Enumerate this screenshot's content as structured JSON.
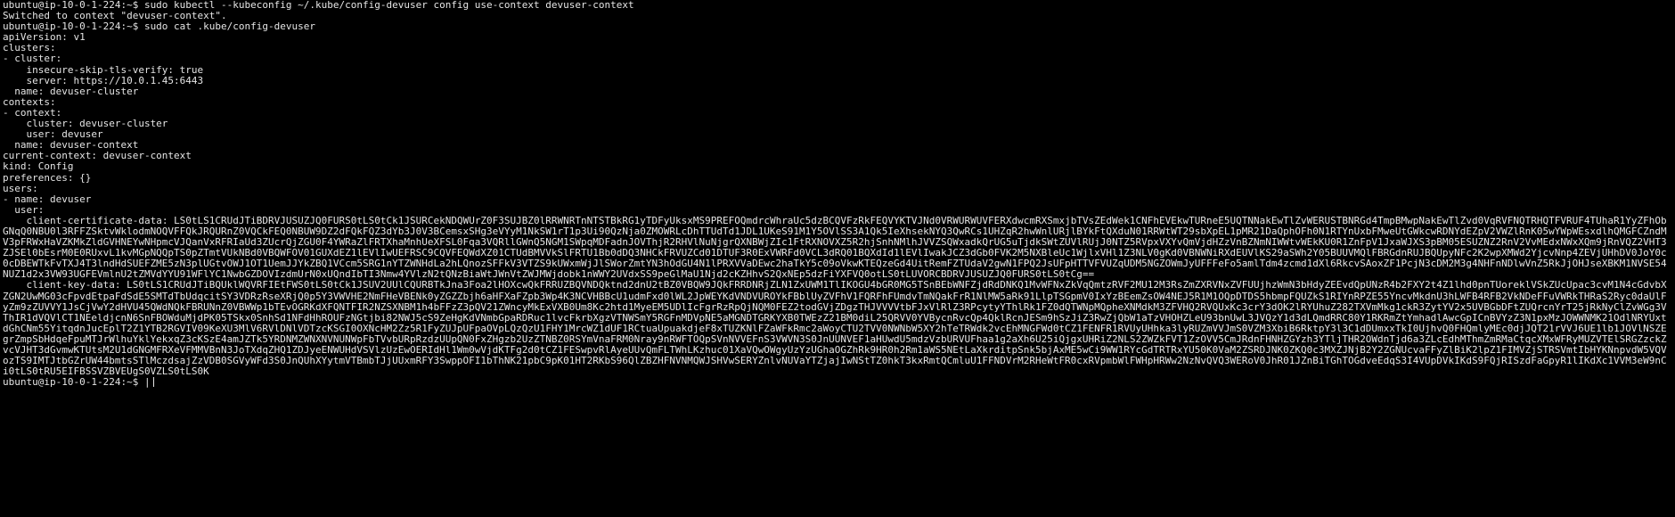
{
  "colors": {
    "background": "#000000",
    "foreground": "#e5e5e5"
  },
  "terminal": {
    "lines": [
      "ubuntu@ip-10-0-1-224:~$ sudo kubectl --kubeconfig ~/.kube/config-devuser config use-context devuser-context",
      "Switched to context \"devuser-context\".",
      "ubuntu@ip-10-0-1-224:~$ sudo cat .kube/config-devuser",
      "apiVersion: v1",
      "clusters:",
      "- cluster:",
      "    insecure-skip-tls-verify: true",
      "    server: https://10.0.1.45:6443",
      "  name: devuser-cluster",
      "contexts:",
      "- context:",
      "    cluster: devuser-cluster",
      "    user: devuser",
      "  name: devuser-context",
      "current-context: devuser-context",
      "kind: Config",
      "preferences: {}",
      "users:",
      "- name: devuser",
      "  user:"
    ],
    "client_certificate_data": "    client-certificate-data: LS0tLS1CRUdJTiBDRVJUSUZJQ0FURS0tLS0tCk1JSURCekNDQWUrZ0F3SUJBZ0lRRWNRTnNTSTBkRG1yTDFyUksxMS9PREFOQmdrcWhraUc5dzBCQVFzRkFEQVYKTVJNd0VRWURWUVFERXdwcmRXSmxjbTVsZEdWek1CNFhEVEkwTURneE5UQTNNakEwTlZvWERUSTBNRGd4TmpBMwpNakEwTlZvd0VqRVFNQTRHQTFVRUF4TUhaR1YyZFhObGNqQ0NBU0l3RFFZSktvWklodmNOQVFFQkJRQURnZ0VQCkFEQ0NBUW9DZ2dFQkFQZ3dYb3J0V3BCemsxSHg3eVYyM1NkSW1rT1p3Ui90QzNja0ZMOWRLcDhTTUdTd1JDL1UKeS91M1Y5OVlSS3A1Qk5IeXhsekNYQ3QwRCs1UHZqR2hwWnlURjlBYkFtQXduN01RRWtWT29sbXpEL1pMR21DaQphOFh0N1RTYnUxbFMweUtGWkcwRDNYdEZpV2VWZlRnK05wYWpWEsxdlhQMGFCZndMV3pFRWxHaVZKMkZldGVHNEYwNHpmcVJQanVxRFRIaUd3ZUcrQjZGU0F4YWRaZlFRTXhaMnhUeXFSL0Fqa3VQRllGWnQ5NGM1SWpqMDFadnJOVThjR2RHVlNuNjgrQXNBWjZIc1FtRXNOVXZ5R2hjSnhNMlhJVVZSQWxadkQrUG5uTjdkSWtZUVlRUjJ0NTZ5RVpxVXYvQmVjdHZzVnBZNmNIWWtvWEkKU0R1ZnFpV1JxaWJXS3pBM05ESUZNZ2RnV2VvMEdxNWxXQm9jRnVQZ2VHT3ZJSEl0bEsrM0E0RUxvL1kvMGpNQQpTS0pZTmtVUkNBd0VBQWFOV01GUXdEZ1lEVlIwUEFRSC9CQVFEQWdXZ01CTUdBMVVkSlFRTU1Bb0dDQ3NHCkFRVUZCd01DTUF3R0ExVWRFd0VCL3dRQ01BQXdId1lEVlIwakJCZ3dGb0FVK2M5NXBleUc1WjlxVHl1Z3NLV0gKd0VBNWNiRXdEUVlKS29aSWh2Y05BUUVMQlFBRGdnRUJBQUpyNFc2K2wpXMWd2YjcvNnp4ZEVjUHhDV0JoY0c0cDBEWTkFvTXJ4T3lndHdSUEFZME5zN3plUGtvOWJ1OT1UemJJYkZBQ1VCcm5SRG1nYTZWNHdLa2hLQnozSFFkV3VTZS9kUWxmWjJlSWorZmtYN3hOdGU4N1lPRXVVaDEwc2haTkY5c09oVkwKTEQzeGd4UitRemFZTUdaV2gwN1FPQ2JsUFpHTTVFVUZqUDM5NGZOWmJyUFFFeFo5amlTdm4zcmd1dXl6RkcvSAoxZF1PcjN3cDM2M3g4NHFnNDlwVnZ5RkJjOHJseXBKM1NVSE54NUZ1d2x3VW93UGFEVmlnU2tZMVdYYU91WFlYC1NwbGZDOVIzdmUrN0xUQndIbTI3Nmw4YVlzN2tQNzBiaWtJWnVtZWJMWjdobk1nWWY2UVdxSS9peGlMaU1Njd2cKZHhvS2QxNEp5dzFiYXFVQ0otLS0tLUVORCBDRVJUSUZJQ0FURS0tLS0tCg==",
    "client_key_data": "    client-key-data: LS0tLS1CRUdJTiBQUklWQVRFIEtFWS0tLS0tCk1JSUV2UUlCQURBTkJna3Foa2lHOXcwQkFRRUZBQVNDQktnd2dnU2tBZ0VBQW9JQkFRRDNRjZLN1ZxUWM1TlIKOGU4bGR0MG5TSnBEbWNFZjdRdDNKQ1MvWFNxZkVqQmtzRVF2MU12M3RsZmZXRVNxZVFUUjhzWmN3bHdyZEEvdQpUNzR4b2FXY2t4Z1lhd0pnTUoreklVSkZUcUpac3cvM1N4cGdvbXZGN2UwMG03cFpvdEtpaFdSdE5SMTdTbUdqcitSY3VDRzRseXRjQ0p5Y3VWVHE2NmFHeVBENk0yZGZZbjh6aHFXaFZpb3Wp4K3NCVHBBcU1udmFxd0lWL2JpWEYKdVNDVUROYkFBblUyZVFhV1FQRFhFUmdvTmNQakFrR1NlMW5aRk91LlpTSGpmV0IxYzBEemZsOW4NEJ5R1M1OQpDTDS5hbmpFQUZkS1RIYnRPZE55YncvMkdnU3hLWFB4RFB2VkNDeFFuVWRkTHRaS2Ryc0daUlFyZm9zZUVVY1JsCjVwY2dHVU45QWdNQkFBRUNnZ0VBWWp1bTEvOGRKdXFQNTFIR2NZSXNBM1h4bFFzZ3pQV21ZWncyMkExVXB0Um8Kc2htd1MyeEM5UDlIcFgrRzRpQjNQM0FEZ2todGVjZDgzTHJVVVVtbFJxVlRlZ3RPcytyYThlRk1FZ0dQTWNpMQpheXNMdkM3ZFVHQ2RVQUxKc3crY3dOK2lRYUhuZ282TXVmMkg1ckR3ZytYV2x5UVBGbDFtZUQrcnYrT25jRkNyClZvWGg3VThIR1dVQVlCT1NEeldjcnN6SnFBOWduMjdPK05TSkx0SnhSd1NFdHhROUFzNGtjbi82NWJ5cS9ZeHgKdVNmbGpaRDRuc1lvcFkrbXgzVTNWSmY5RGFnMDVpNE5aMGNDTGRKYXB0TWEzZ21BM0diL25QRVV0YVBycnRvcQp4QklRcnJESm9hSzJiZ3RwZjQbW1aTzVHOHZLeU93bnUwL3JVQzY1d3dLQmdRRC80Y1RKRmZtYmhadlAwcGpICnBVYzZ3N1pxMzJOWWNMK21OdlNRYUxtdGhCNm55YitqdnJucEplT2Z1YTB2RGVIV09KeXU3MlV6RVlDNlVDTzcKSGI0OXNcHM2Zz5R1FyZUJpUFpaOVpLQzQzU1FHY1MrcWZ1dUF1RCtuaUpuakdjeF8xTUZKNlFZaWFkRmc2aWoyCTU2TVV0NWNbW5XY2hTeTRWdk2vcEhMNGFWd0tCZ1FENFR1RVUyUHhka3lyRUZmVVJmS0VZM3XbiB6RktpY3l3C1dDUmxxTkI0UjhvQ0FHQmlyMEc0djJQT21rVVJ6UE1lb1JOVlNSZEgrZmpSbHdqeFpuMTJrWlhuYklYekxqZ3cKSzE4amJZTk5YRDNMZWNXNVNUNWpFbTVvbURpRzdzUUpQN0FxZHgzb2UzZTNBZ0RSYmVnaFRM0Nray9nRWFTOQpSVnNVVEFnS3VWVN3S0JnUUNVEF1aHUwdU5mdzVzbURVUFhaa1g2aXh6U25iQjgxUHRiZ2NLS2ZWZkFVT1ZzOVV5CmJRdnFHNHZGYzh3YTljTHR2OWdnTjd6a3ZLcEdhMThmZmRMaCtqcXMxWFRyMUZVTElSRGZzckZvcVJHT3dGvmwKTUtsM2U1dGNGMFRXeVFMMVBnN3JoTXdqZHQ1ZDJyeENWUHdVSVlzUzEwOERIdHl1Wm0wVjdKTFg2d0tCZ1FESwpvRlAyeUUvQmFLTWhLKzhuc01XaVQwOWgyUzYzUGhaOGZhRk9HR0h2Rm1aWS5NEtLaXkrditpSnk5bjAxME5wCi9WW1RYcGdTRTRxYU50K0VaM2ZSRDJNK0ZKQ0c3MXZJNjB2Y2ZGNUcvaFFyZlBiK2lpZ1FIMVZjSTRSVmtIbHYKNnpvdW5VQVozTS9IMTJtbGZrUW44bmtsSTlMczdsajZzVDB0SGVyWFd3S0JnQUhXYytmVTBmbTJjUUxmRFY3SwppOFI1bThNK21pbC9pK01HT2RKbS96QlZBZHFNVNMQWJSHVwSERYZnlvNUVaYTZjajIwNStTZ0hkT3kxRmtQCmluU1FFNDVrM2RHeWtFR0cxRVpmbWlFWHpHRWw2NzNvQVQ3WERoV0JhR01JZnBiTGhTOGdveEdqS3I4VUpDVkIKdS9FQjRISzdFaGpyR1lIKdXc1VVM3eW9nCi0tLS0tRU5EIFBSSVZBVEUgS0VZLS0tLS0K",
    "prompt": "ubuntu@ip-10-0-1-224:~$ |"
  }
}
